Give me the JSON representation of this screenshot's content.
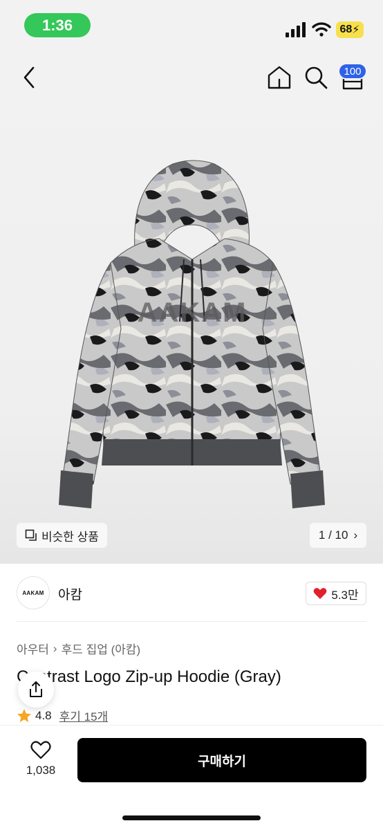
{
  "status_bar": {
    "time": "1:36",
    "battery": "68"
  },
  "header": {
    "cart_count": "100"
  },
  "gallery": {
    "similar_label": "비슷한 상품",
    "pager": "1 / 10"
  },
  "brand": {
    "logo_text": "AAKAM",
    "name": "아캄",
    "likes": "5.3만"
  },
  "product": {
    "category": "아우터",
    "subcategory": "후드 집업 (아캄)",
    "title": "Contrast Logo Zip-up Hoodie (Gray)",
    "rating": "4.8",
    "reviews": "후기 15개"
  },
  "bottom_bar": {
    "wish_count": "1,038",
    "buy_label": "구매하기"
  },
  "colors": {
    "accent_blue": "#2e63e8",
    "heart_red": "#e0202b",
    "star_orange": "#f5a623",
    "buy_bg": "#000000",
    "time_green": "#34c759"
  }
}
